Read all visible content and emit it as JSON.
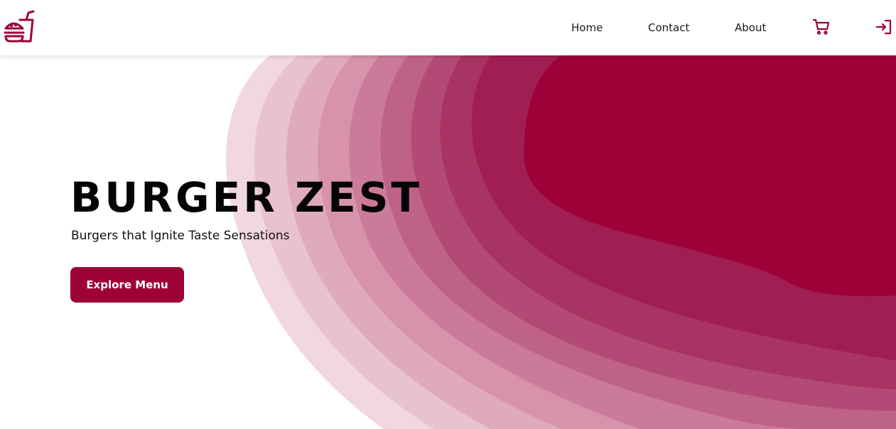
{
  "brand": {
    "logo_icon": "burger-drink-logo-icon",
    "accent_color": "#9e0038"
  },
  "nav": {
    "items": [
      {
        "label": "Home"
      },
      {
        "label": "Contact"
      },
      {
        "label": "About"
      }
    ],
    "cart_icon": "cart-icon",
    "login_icon": "login-icon"
  },
  "hero": {
    "title": "BURGER ZEST",
    "subtitle": "Burgers that Ignite Taste Sensations",
    "cta_label": "Explore Menu"
  }
}
